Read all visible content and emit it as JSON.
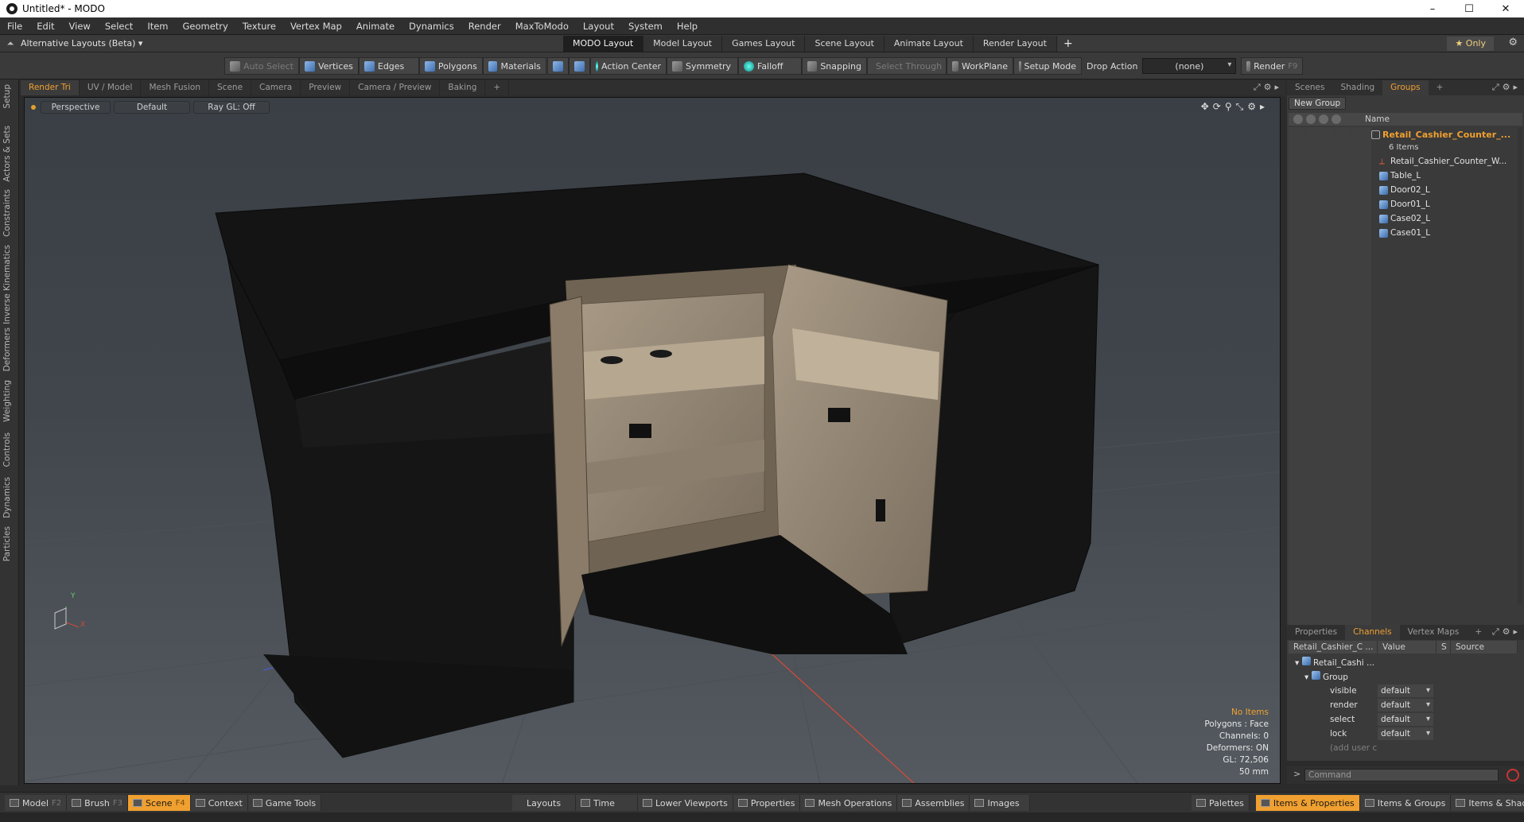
{
  "window": {
    "title": "Untitled* - MODO",
    "controls": [
      "–",
      "☐",
      "✕"
    ]
  },
  "menubar": [
    "File",
    "Edit",
    "View",
    "Select",
    "Item",
    "Geometry",
    "Texture",
    "Vertex Map",
    "Animate",
    "Dynamics",
    "Render",
    "MaxToModo",
    "Layout",
    "System",
    "Help"
  ],
  "layoutrow": {
    "alt_layouts": "Alternative Layouts (Beta) ▾",
    "tabs": [
      "MODO Layout",
      "Model Layout",
      "Games Layout",
      "Scene Layout",
      "Animate Layout",
      "Render Layout"
    ],
    "active_tab": "MODO Layout",
    "plus": "+",
    "only": "★  Only"
  },
  "toolbar": {
    "auto_select": "Auto Select",
    "vertices": "Vertices",
    "edges": "Edges",
    "polygons": "Polygons",
    "materials": "Materials",
    "action_center": "Action Center",
    "symmetry": "Symmetry",
    "falloff": "Falloff",
    "snapping": "Snapping",
    "select_through": "Select Through",
    "workplane": "WorkPlane",
    "setup_mode": "Setup Mode",
    "drop_action_label": "Drop Action",
    "drop_action_value": "(none)",
    "render": "Render",
    "render_key": "F9"
  },
  "left_tabs": [
    "Setup",
    "Actors & Sets",
    "Constraints",
    "Inverse Kinematics",
    "Deformers",
    "Weighting",
    "Controls",
    "Dynamics",
    "Particles"
  ],
  "viewport_tabs": [
    "Render Tri",
    "UV / Model",
    "Mesh Fusion",
    "Scene",
    "Camera",
    "Preview",
    "Camera / Preview",
    "Baking",
    "+"
  ],
  "viewport": {
    "perspective": "Perspective",
    "shading": "Default",
    "raygl": "Ray GL: Off",
    "axis_y": "Y",
    "axis_x": "X",
    "info": {
      "items": "No Items",
      "polygons": "Polygons : Face",
      "channels": "Channels: 0",
      "deformers": "Deformers: ON",
      "gl": "GL: 72,506",
      "focal": "50 mm"
    }
  },
  "right_tabs": [
    "Scenes",
    "Shading",
    "Groups",
    "+"
  ],
  "groups": {
    "new_group": "New Group",
    "name_col": "Name",
    "root": "Retail_Cashier_Counter_...",
    "root_count": "6 Items",
    "children": [
      {
        "label": "Retail_Cashier_Counter_W...",
        "icon": "locator-icon"
      },
      {
        "label": "Table_L",
        "icon": "mesh-icon"
      },
      {
        "label": "Door02_L",
        "icon": "mesh-icon"
      },
      {
        "label": "Door01_L",
        "icon": "mesh-icon"
      },
      {
        "label": "Case02_L",
        "icon": "mesh-icon"
      },
      {
        "label": "Case01_L",
        "icon": "mesh-icon"
      }
    ]
  },
  "channel_tabs": [
    "Properties",
    "Channels",
    "Vertex Maps",
    "+"
  ],
  "channels": {
    "col_name": "Retail_Cashier_C ...",
    "col_value": "Value",
    "col_s": "S",
    "col_source": "Source",
    "item": "Retail_Cashi ...",
    "group": "Group",
    "rows": [
      {
        "name": "visible",
        "value": "default"
      },
      {
        "name": "render",
        "value": "default"
      },
      {
        "name": "select",
        "value": "default"
      },
      {
        "name": "lock",
        "value": "default"
      }
    ],
    "add_user": "(add user c..."
  },
  "command": {
    "prompt": ">",
    "placeholder": "Command"
  },
  "bottombar": {
    "left": [
      {
        "label": "Model",
        "key": "F2"
      },
      {
        "label": "Brush",
        "key": "F3"
      },
      {
        "label": "Scene",
        "key": "F4",
        "active": true
      },
      {
        "label": "Context",
        "key": ""
      },
      {
        "label": "Game Tools",
        "key": ""
      }
    ],
    "middle": [
      "Layouts",
      "Time",
      "Lower Viewports",
      "Properties",
      "Mesh Operations",
      "Assemblies",
      "Images"
    ],
    "right": [
      "Palettes",
      "Items & Properties",
      "Items & Groups",
      "Items & Shading"
    ],
    "right_active": "Items & Properties"
  },
  "colors": {
    "accent": "#f0a030",
    "bg": "#2b2b2b",
    "viewport_top": "#3a3f45",
    "viewport_bottom": "#545a60"
  }
}
